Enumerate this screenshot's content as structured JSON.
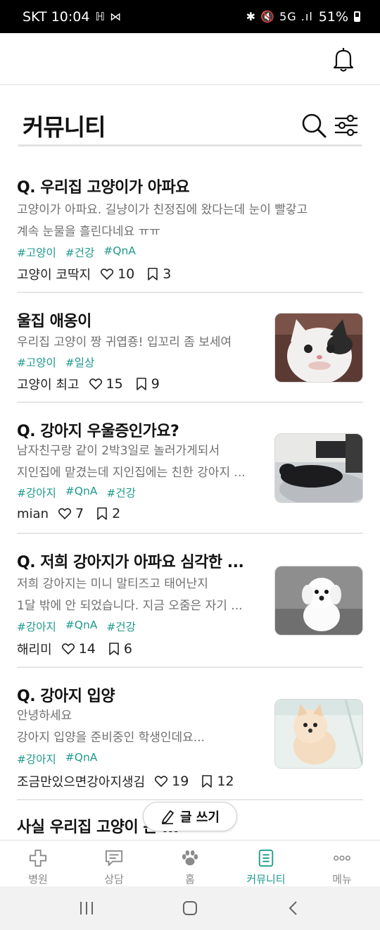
{
  "status_bar": {
    "carrier_time": "SKT 10:04",
    "left_icons": "ℍ ⋈",
    "right_icons": "✱ 🔇 5G .ıl",
    "battery": "51%"
  },
  "header": {
    "title": "커뮤니티",
    "icons": [
      "bell-icon",
      "search-icon",
      "filter-icon"
    ]
  },
  "posts": [
    {
      "title": "Q. 우리집 고양이가 아파요",
      "body": [
        "고양이가 아파요. 길냥이가 친정집에 왔다는데 눈이 빨갛고",
        "계속 눈물을 흘린다네요 ㅠㅠ"
      ],
      "tags": [
        "#고양이",
        "#건강",
        "#QnA"
      ],
      "author": "고양이 코딱지",
      "likes": "10",
      "saves": "3",
      "thumbnail": ""
    },
    {
      "title": "울집 애옹이",
      "body": [
        "우리집 고양이 짱 귀엽죵! 입꼬리 좀 보세여"
      ],
      "tags": [
        "#고양이",
        "#일상"
      ],
      "author": "고양이 최고",
      "likes": "15",
      "saves": "9",
      "thumbnail": "cat-photo"
    },
    {
      "title": "Q. 강아지 우울증인가요?",
      "body": [
        "남자친구랑 같이 2박3일로 놀러가게되서",
        "지인집에 맡겼는데 지인집에는 친한 강아지 ..."
      ],
      "tags": [
        "#강아지",
        "#QnA",
        "#건강"
      ],
      "author": "mian",
      "likes": "7",
      "saves": "2",
      "thumbnail": "dog-sleeping-photo"
    },
    {
      "title": "Q. 저희 강아지가 아파요 심각한 ...",
      "body": [
        "저희 강아지는 미니 말티즈고 태어난지",
        "1달 밖에 안 되었습니다. 지금 오줌은 자기 ..."
      ],
      "tags": [
        "#강아지",
        "#QnA",
        "#건강"
      ],
      "author": "해리미",
      "likes": "14",
      "saves": "6",
      "thumbnail": "maltese-puppy-photo"
    },
    {
      "title": "Q. 강아지 입양",
      "body": [
        "안녕하세요",
        "강아지 입양을 준비중인 학생인데요..."
      ],
      "tags": [
        "#강아지",
        "#QnA"
      ],
      "author": "조금만있으면강아지생김",
      "likes": "19",
      "saves": "12",
      "thumbnail": "pomeranian-puppy-photo"
    },
    {
      "title": "사실 우리집 고양이 는 ...",
      "body": [],
      "tags": [],
      "author": "",
      "likes": "",
      "saves": "",
      "thumbnail": ""
    }
  ],
  "write_button": {
    "label": "글 쓰기",
    "icon": "pencil-icon"
  },
  "bottom_nav": [
    {
      "label": "병원",
      "icon": "hospital-cross-icon",
      "active": false
    },
    {
      "label": "상담",
      "icon": "chat-icon",
      "active": false
    },
    {
      "label": "홈",
      "icon": "paw-icon",
      "active": false
    },
    {
      "label": "커뮤니티",
      "icon": "document-icon",
      "active": true
    },
    {
      "label": "메뉴",
      "icon": "more-icon",
      "active": false
    }
  ],
  "colors": {
    "accent": "#1e9a8c",
    "inactive": "#8a8a8a",
    "divider": "#e5e5e5"
  }
}
